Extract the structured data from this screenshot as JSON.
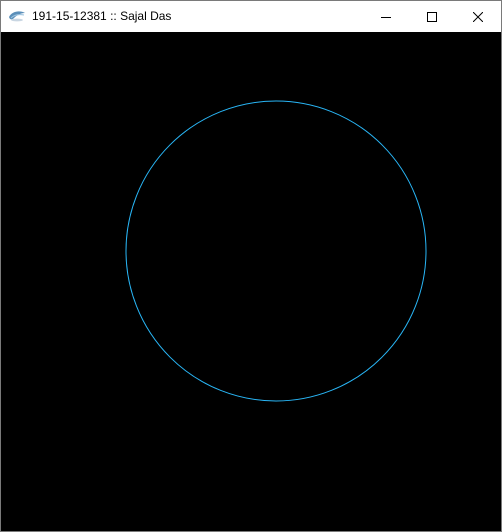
{
  "window": {
    "title": "191-15-12381 :: Sajal Das",
    "controls": {
      "minimize": "minimize-icon",
      "maximize": "maximize-icon",
      "close": "close-icon"
    }
  },
  "canvas": {
    "background": "#000000",
    "stroke_color": "#29b6f6",
    "shape": "circle"
  }
}
